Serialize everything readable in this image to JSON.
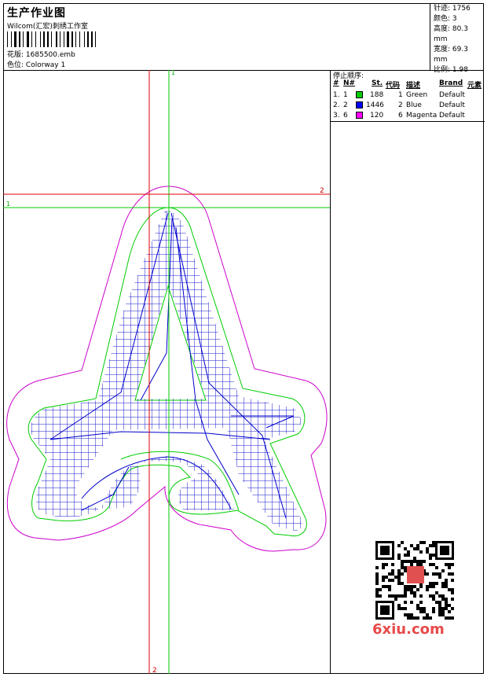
{
  "header": {
    "title": "生产作业图",
    "company": "Wilcom(汇宏)刺绣工作室",
    "design_label": "花版:",
    "design_value": "1685500.emb",
    "colorway_label": "色位:",
    "colorway_value": "Colorway 1"
  },
  "specs": {
    "stitches": "针迹: 1756",
    "colors": "颜色: 3",
    "height": "高度: 80.3 mm",
    "width": "宽度: 69.3 mm",
    "scale": "比例: 1.98"
  },
  "stop_sequence": {
    "title": "停止顺序:",
    "headers": {
      "num": "#",
      "needle": "N#",
      "stitches": "St.",
      "code": "代码",
      "desc": "描述",
      "brand": "Brand",
      "elem": "元素"
    },
    "rows": [
      {
        "num": "1.",
        "needle": "1",
        "stitches": "188",
        "code": "1",
        "desc": "Green",
        "brand": "Default",
        "color": "#00cc00"
      },
      {
        "num": "2.",
        "needle": "2",
        "stitches": "1446",
        "code": "2",
        "desc": "Blue",
        "brand": "Default",
        "color": "#0000ff"
      },
      {
        "num": "3.",
        "needle": "6",
        "stitches": "120",
        "code": "6",
        "desc": "Magenta",
        "brand": "Default",
        "color": "#ff00ff"
      }
    ]
  },
  "guides": {
    "green_h": "1",
    "green_v": "1",
    "red_h": "2",
    "red_v": "2"
  },
  "colors": {
    "green": "#00cc00",
    "blue": "#0000cc",
    "magenta": "#cc00cc",
    "red": "#e00000"
  },
  "watermark": "6xiu.com"
}
